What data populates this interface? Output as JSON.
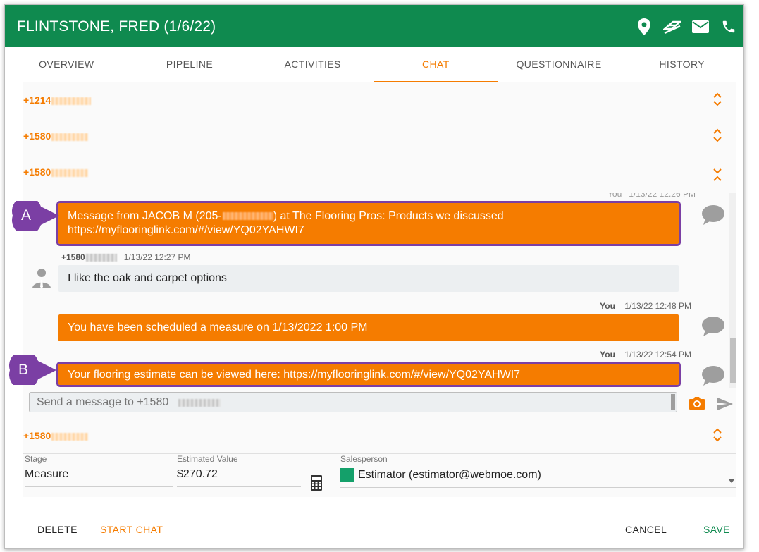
{
  "header": {
    "title": "FLINTSTONE, FRED (1/6/22)",
    "bg_color": "#0f8a4f",
    "icons": [
      "map-pin-icon",
      "leads-icon",
      "email-icon",
      "phone-icon"
    ]
  },
  "tabs": [
    {
      "label": "OVERVIEW",
      "active": false
    },
    {
      "label": "PIPELINE",
      "active": false
    },
    {
      "label": "ACTIVITIES",
      "active": false
    },
    {
      "label": "CHAT",
      "active": true
    },
    {
      "label": "QUESTIONNAIRE",
      "active": false
    },
    {
      "label": "HISTORY",
      "active": false
    }
  ],
  "accent_color": "#f57c00",
  "phones": [
    {
      "prefix": "+1214"
    },
    {
      "prefix": "+1580"
    },
    {
      "prefix": "+1580"
    },
    {
      "prefix": "+1580"
    }
  ],
  "messages": [
    {
      "direction": "out",
      "text": "Message from JACOB M (205-",
      "text_after": ") at The Flooring Pros: Products we discussed",
      "text_line2": "https://myflooringlink.com/#/view/YQ02YAHWI7",
      "callout": "A"
    },
    {
      "direction": "in",
      "sender_prefix": "+1580",
      "timestamp": "1/13/22 12:27 PM",
      "text": "I like the oak and carpet options"
    },
    {
      "direction": "out",
      "sender": "You",
      "timestamp": "1/13/22 12:48 PM",
      "text": "You have been scheduled a measure on 1/13/2022 1:00 PM"
    },
    {
      "direction": "out",
      "sender": "You",
      "timestamp": "1/13/22 12:54 PM",
      "text": "Your flooring estimate can be viewed here: https://myflooringlink.com/#/view/YQ02YAHWI7",
      "callout": "B"
    }
  ],
  "composer": {
    "placeholder": "Send a message to +1580"
  },
  "form": {
    "stage_label": "Stage",
    "stage_value": "Measure",
    "estimated_label": "Estimated Value",
    "estimated_value": "$270.72",
    "salesperson_label": "Salesperson",
    "salesperson_value": "Estimator (estimator@webmoe.com)",
    "salesperson_color": "#14a06a"
  },
  "footer": {
    "delete": "DELETE",
    "start_chat": "START CHAT",
    "cancel": "CANCEL",
    "save": "SAVE",
    "save_color": "#0f8a4f"
  },
  "callout_color": "#7b3fa4"
}
